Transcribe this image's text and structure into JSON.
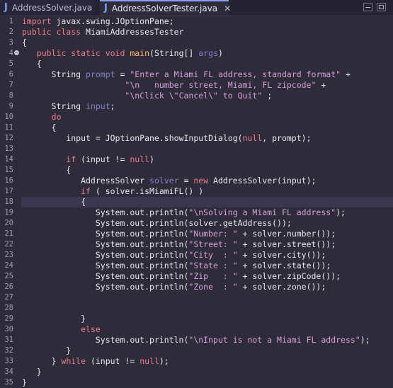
{
  "tabs": [
    {
      "label": "AddressSolver.java",
      "icon": "java-file-icon",
      "active": false
    },
    {
      "label": "AddressSolverTester.java",
      "icon": "java-file-icon",
      "active": true
    }
  ],
  "editor": {
    "highlighted_line": 18,
    "lines": [
      {
        "n": "1",
        "t": [
          {
            "c": "kw",
            "v": "import"
          },
          {
            "c": "pl",
            "v": " javax.swing.JOptionPane;"
          }
        ]
      },
      {
        "n": "2",
        "t": [
          {
            "c": "kw",
            "v": "public class"
          },
          {
            "c": "pl",
            "v": " MiamiAddressesTester"
          }
        ]
      },
      {
        "n": "3",
        "t": [
          {
            "c": "pl",
            "v": "{"
          }
        ]
      },
      {
        "n": "4",
        "fold": true,
        "t": [
          {
            "c": "kw",
            "v": "   public static void"
          },
          {
            "c": "pl",
            "v": " "
          },
          {
            "c": "fn",
            "v": "main"
          },
          {
            "c": "pl",
            "v": "(String[] "
          },
          {
            "c": "var",
            "v": "args"
          },
          {
            "c": "pl",
            "v": ")"
          }
        ]
      },
      {
        "n": "5",
        "t": [
          {
            "c": "pl",
            "v": "   {"
          }
        ]
      },
      {
        "n": "6",
        "t": [
          {
            "c": "pl",
            "v": "      String "
          },
          {
            "c": "var",
            "v": "prompt"
          },
          {
            "c": "pl",
            "v": " = "
          },
          {
            "c": "str",
            "v": "\"Enter a Miami FL address, standard format\""
          },
          {
            "c": "pl",
            "v": " +"
          }
        ]
      },
      {
        "n": "7",
        "t": [
          {
            "c": "pl",
            "v": "                     "
          },
          {
            "c": "str",
            "v": "\"\\n   number street, Miami, FL zipcode\""
          },
          {
            "c": "pl",
            "v": " +"
          }
        ]
      },
      {
        "n": "8",
        "t": [
          {
            "c": "pl",
            "v": "                     "
          },
          {
            "c": "str",
            "v": "\"\\nClick \\\"Cancel\\\" to Quit\""
          },
          {
            "c": "pl",
            "v": " ;"
          }
        ]
      },
      {
        "n": "9",
        "t": [
          {
            "c": "pl",
            "v": "      String "
          },
          {
            "c": "var",
            "v": "input"
          },
          {
            "c": "pl",
            "v": ";"
          }
        ]
      },
      {
        "n": "10",
        "t": [
          {
            "c": "kw",
            "v": "      do"
          }
        ]
      },
      {
        "n": "11",
        "t": [
          {
            "c": "pl",
            "v": "      {"
          }
        ]
      },
      {
        "n": "12",
        "t": [
          {
            "c": "pl",
            "v": "         input = JOptionPane.showInputDialog("
          },
          {
            "c": "kw",
            "v": "null"
          },
          {
            "c": "pl",
            "v": ", prompt);"
          }
        ]
      },
      {
        "n": "13",
        "t": []
      },
      {
        "n": "14",
        "t": [
          {
            "c": "kw",
            "v": "         if"
          },
          {
            "c": "pl",
            "v": " (input != "
          },
          {
            "c": "kw",
            "v": "null"
          },
          {
            "c": "pl",
            "v": ")"
          }
        ]
      },
      {
        "n": "15",
        "t": [
          {
            "c": "pl",
            "v": "         {"
          }
        ]
      },
      {
        "n": "16",
        "t": [
          {
            "c": "pl",
            "v": "            AddressSolver "
          },
          {
            "c": "var",
            "v": "solver"
          },
          {
            "c": "pl",
            "v": " = "
          },
          {
            "c": "kw",
            "v": "new"
          },
          {
            "c": "pl",
            "v": " AddressSolver(input);"
          }
        ]
      },
      {
        "n": "17",
        "t": [
          {
            "c": "kw",
            "v": "            if"
          },
          {
            "c": "pl",
            "v": " ( solver.isMiamiFL() )"
          }
        ]
      },
      {
        "n": "18",
        "t": [
          {
            "c": "pl",
            "v": "            {"
          }
        ]
      },
      {
        "n": "19",
        "t": [
          {
            "c": "pl",
            "v": "               System.out.println("
          },
          {
            "c": "str",
            "v": "\"\\nSolving a Miami FL address\""
          },
          {
            "c": "pl",
            "v": ");"
          }
        ]
      },
      {
        "n": "20",
        "t": [
          {
            "c": "pl",
            "v": "               System.out.println(solver.getAddress());"
          }
        ]
      },
      {
        "n": "21",
        "t": [
          {
            "c": "pl",
            "v": "               System.out.println("
          },
          {
            "c": "str",
            "v": "\"Number: \""
          },
          {
            "c": "pl",
            "v": " + solver.number());"
          }
        ]
      },
      {
        "n": "22",
        "t": [
          {
            "c": "pl",
            "v": "               System.out.println("
          },
          {
            "c": "str",
            "v": "\"Street: \""
          },
          {
            "c": "pl",
            "v": " + solver.street());"
          }
        ]
      },
      {
        "n": "23",
        "t": [
          {
            "c": "pl",
            "v": "               System.out.println("
          },
          {
            "c": "str",
            "v": "\"City  : \""
          },
          {
            "c": "pl",
            "v": " + solver.city());"
          }
        ]
      },
      {
        "n": "24",
        "t": [
          {
            "c": "pl",
            "v": "               System.out.println("
          },
          {
            "c": "str",
            "v": "\"State : \""
          },
          {
            "c": "pl",
            "v": " + solver.state());"
          }
        ]
      },
      {
        "n": "25",
        "t": [
          {
            "c": "pl",
            "v": "               System.out.println("
          },
          {
            "c": "str",
            "v": "\"Zip   : \""
          },
          {
            "c": "pl",
            "v": " + solver.zipCode());"
          }
        ]
      },
      {
        "n": "26",
        "t": [
          {
            "c": "pl",
            "v": "               System.out.println("
          },
          {
            "c": "str",
            "v": "\"Zone  : \""
          },
          {
            "c": "pl",
            "v": " + solver.zone());"
          }
        ]
      },
      {
        "n": "27",
        "t": []
      },
      {
        "n": "28",
        "t": []
      },
      {
        "n": "29",
        "t": [
          {
            "c": "pl",
            "v": "            }"
          }
        ]
      },
      {
        "n": "30",
        "t": [
          {
            "c": "kw",
            "v": "            else"
          }
        ]
      },
      {
        "n": "31",
        "t": [
          {
            "c": "pl",
            "v": "               System.out.println("
          },
          {
            "c": "str",
            "v": "\"\\nInput is not a Miami FL address\""
          },
          {
            "c": "pl",
            "v": ");"
          }
        ]
      },
      {
        "n": "32",
        "t": [
          {
            "c": "pl",
            "v": "         }"
          }
        ]
      },
      {
        "n": "33",
        "t": [
          {
            "c": "pl",
            "v": "      } "
          },
          {
            "c": "kw",
            "v": "while"
          },
          {
            "c": "pl",
            "v": " (input != "
          },
          {
            "c": "kw",
            "v": "null"
          },
          {
            "c": "pl",
            "v": ");"
          }
        ]
      },
      {
        "n": "34",
        "t": [
          {
            "c": "pl",
            "v": "   }"
          }
        ]
      },
      {
        "n": "35",
        "t": [
          {
            "c": "pl",
            "v": "}"
          }
        ]
      }
    ]
  }
}
